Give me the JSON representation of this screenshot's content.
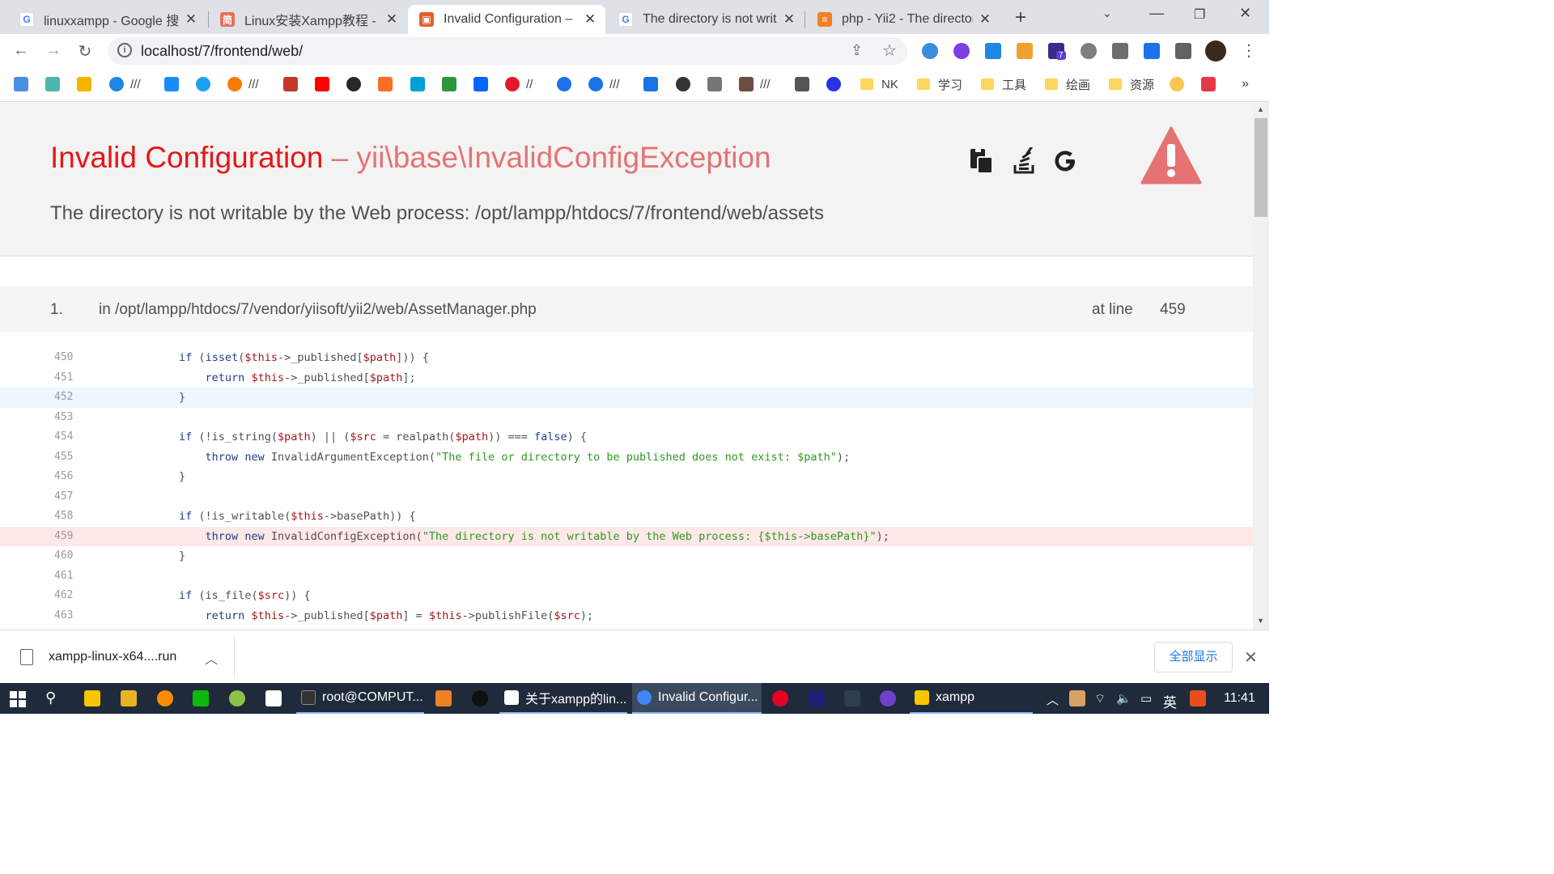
{
  "tabs": [
    {
      "title": "linuxxampp - Google 搜",
      "favicon": "google-icon"
    },
    {
      "title": "Linux安装Xampp教程 - 简",
      "favicon": "jianshu-icon"
    },
    {
      "title": "Invalid Configuration –",
      "favicon": "yii-icon"
    },
    {
      "title": "The directory is not writ",
      "favicon": "google-icon"
    },
    {
      "title": "php - Yii2 - The director",
      "favicon": "stackoverflow-icon"
    }
  ],
  "toolbar": {
    "url": "localhost/7/frontend/web/",
    "ext_badge": "7"
  },
  "bookmarks": {
    "sep1": "///",
    "sep2": "///",
    "sep3": "//",
    "sep4": "///",
    "sep5": "///",
    "folders": [
      "NK",
      "学习",
      "工具",
      "绘画",
      "资源"
    ],
    "more": "»"
  },
  "error": {
    "name": "Invalid Configuration",
    "dash": " – ",
    "exception": "yii\\base\\InvalidConfigException",
    "message": "The directory is not writable by the Web process: /opt/lampp/htdocs/7/frontend/web/assets"
  },
  "callstack": {
    "number": "1.",
    "file": "in /opt/lampp/htdocs/7/vendor/yiisoft/yii2/web/AssetManager.php",
    "at_line_label": "at line",
    "line": "459"
  },
  "code_lines": [
    {
      "n": "450"
    },
    {
      "n": "451"
    },
    {
      "n": "452"
    },
    {
      "n": "453"
    },
    {
      "n": "454"
    },
    {
      "n": "455"
    },
    {
      "n": "456"
    },
    {
      "n": "457"
    },
    {
      "n": "458"
    },
    {
      "n": "459"
    },
    {
      "n": "460"
    },
    {
      "n": "461"
    },
    {
      "n": "462"
    },
    {
      "n": "463"
    }
  ],
  "code_text": {
    "l450": [
      "        ",
      "if",
      " (",
      "isset",
      "(",
      "$this",
      "->_published[",
      "$path",
      "])) {"
    ],
    "l451": [
      "            ",
      "return",
      " ",
      "$this",
      "->_published[",
      "$path",
      "];"
    ],
    "l452": "        }",
    "l454": [
      "        ",
      "if",
      " (!is_string(",
      "$path",
      ") || (",
      "$src",
      " = realpath(",
      "$path",
      ")) === ",
      "false",
      ") {"
    ],
    "l455": [
      "            ",
      "throw",
      " ",
      "new",
      " InvalidArgumentException(",
      "\"The file or directory to be published does not exist: $path\"",
      ");"
    ],
    "l456": "        }",
    "l458": [
      "        ",
      "if",
      " (!is_writable(",
      "$this",
      "->basePath)) {"
    ],
    "l459": [
      "            ",
      "throw",
      " ",
      "new",
      " InvalidConfigException(",
      "\"The directory is not writable by the Web process: {$this->basePath}\"",
      ");"
    ],
    "l460": "        }",
    "l462": [
      "        ",
      "if",
      " (is_file(",
      "$src",
      ")) {"
    ],
    "l463": [
      "            ",
      "return",
      " ",
      "$this",
      "->_published[",
      "$path",
      "] = ",
      "$this",
      "->publishFile(",
      "$src",
      ");"
    ]
  },
  "download": {
    "filename": "xampp-linux-x64....run",
    "show_all": "全部显示"
  },
  "taskbar": {
    "apps": [
      {
        "label": "root@COMPUT..."
      },
      {
        "label": "关于xampp的lin..."
      },
      {
        "label": "Invalid Configur..."
      },
      {
        "label": "xampp"
      }
    ],
    "ime": "英",
    "time": "11:41"
  }
}
